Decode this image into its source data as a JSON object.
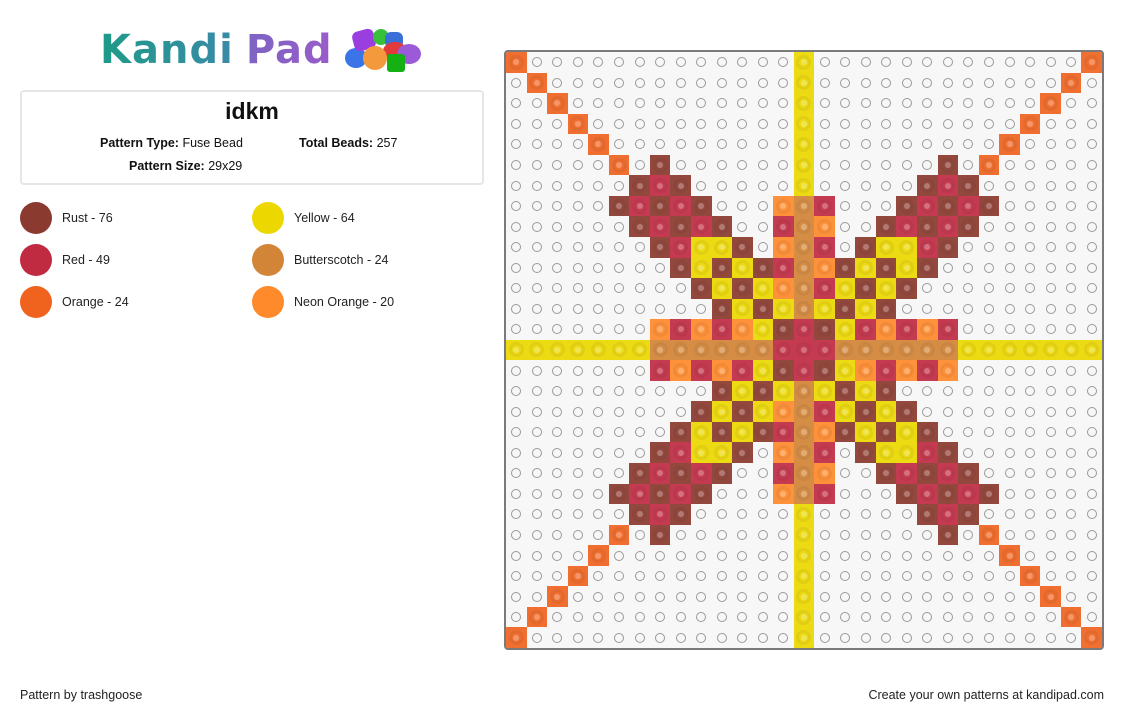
{
  "logo": {
    "kandi": "Kandi",
    "pad": "Pad",
    "icon": "bead-pile-icon"
  },
  "pattern": {
    "title": "idkm",
    "type_label": "Pattern Type:",
    "type_value": "Fuse Bead",
    "total_label": "Total Beads:",
    "total_value": "257",
    "size_label": "Pattern Size:",
    "size_value": "29x29"
  },
  "legend": [
    {
      "key": "Ru",
      "name": "Rust",
      "count": 76,
      "label": "Rust - 76",
      "color": "#8b3a2f"
    },
    {
      "key": "Y",
      "name": "Yellow",
      "count": 64,
      "label": "Yellow - 64",
      "color": "#ecd800"
    },
    {
      "key": "Rd",
      "name": "Red",
      "count": 49,
      "label": "Red - 49",
      "color": "#c02b42"
    },
    {
      "key": "B",
      "name": "Butterscotch",
      "count": 24,
      "label": "Butterscotch - 24",
      "color": "#d38537"
    },
    {
      "key": "O",
      "name": "Orange",
      "count": 24,
      "label": "Orange - 24",
      "color": "#f0631f"
    },
    {
      "key": "NO",
      "name": "Neon Orange",
      "count": 20,
      "label": "Neon Orange - 20",
      "color": "#ff8a2c"
    }
  ],
  "grid": {
    "cols": 29,
    "rows": 29,
    "cells": [
      "O.............Y.............O",
      ".O............Y............O.",
      "..O...........Y...........O..",
      "...O..........Y..........O...",
      "....O.........Y.........O....",
      ".....O.r......Y......r.O.....",
      "......rRr.....Y.....rRr......",
      ".....rRrRr...nBR...rRrRr.....",
      "......rRrRr..RBn..rRrRr......",
      ".......rRYYr.nBR.rYYRr.......",
      "........rYrYrRBnrYrYr........",
      ".........rYrYnBRYrYr.........",
      "..........rYrYBYrYr..........",
      ".......nRnRnYrRrYRnRnR.......",
      "YYYYYYYBBBBBBRRRBBBBBBYYYYYYY",
      ".......RnRnRYrRrYnRnRn.......",
      "..........rYrYBYrYr..........",
      ".........rYrYnBRYrYr.........",
      "........rYrYrRBnrYrYr........",
      ".......rRYYr.nBR.rYYRr.......",
      "......rRrRr..RBn..rRrRr......",
      ".....rRrRr...nBR...rRrRr.....",
      "......rRr.....Y.....rRr......",
      ".....O.r......Y......r.O.....",
      "....O.........Y.........O....",
      "...O..........Y..........O...",
      "..O...........Y...........O..",
      ".O............Y............O.",
      "O.............Y.............O"
    ],
    "code_map": {
      "r": "Ru",
      "R": "Rd",
      "Y": "Y",
      "B": "B",
      "O": "O",
      "n": "NO"
    }
  },
  "footer": {
    "author": "Pattern by trashgoose",
    "promo": "Create your own patterns at kandipad.com"
  }
}
